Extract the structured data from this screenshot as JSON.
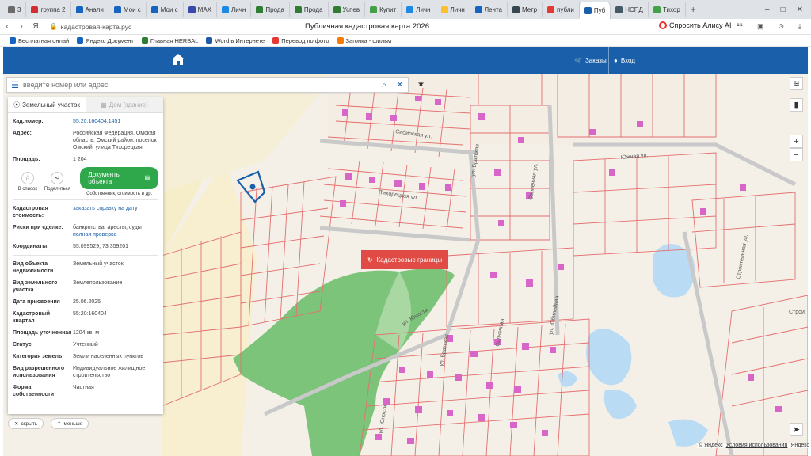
{
  "browser": {
    "tabs": [
      {
        "label": "3",
        "color": "#6b6b6b"
      },
      {
        "label": "группа 2",
        "color": "#d32f2f"
      },
      {
        "label": "Анали",
        "color": "#1565c0"
      },
      {
        "label": "Мои с",
        "color": "#1565c0"
      },
      {
        "label": "Мои с",
        "color": "#1565c0"
      },
      {
        "label": "MAX",
        "color": "#3949ab"
      },
      {
        "label": "Личн",
        "color": "#1e88e5"
      },
      {
        "label": "Прода",
        "color": "#2e7d32"
      },
      {
        "label": "Прода",
        "color": "#2e7d32"
      },
      {
        "label": "Успев",
        "color": "#2e7d32"
      },
      {
        "label": "Купит",
        "color": "#43a047"
      },
      {
        "label": "Личн",
        "color": "#1e88e5"
      },
      {
        "label": "Личн",
        "color": "#fbc02d"
      },
      {
        "label": "Лента",
        "color": "#1565c0"
      },
      {
        "label": "Метр",
        "color": "#37474f"
      },
      {
        "label": "публи",
        "color": "#e53935"
      },
      {
        "label": "Пуб",
        "color": "#1a5fa9",
        "active": true
      },
      {
        "label": "НСПД",
        "color": "#455a64"
      },
      {
        "label": "Тихор",
        "color": "#43a047"
      }
    ],
    "new_tab": "+",
    "url": "кадастровая-карта.рус",
    "page_title": "Публичная кадастровая карта 2026",
    "alisa": "Спросить Алису AI",
    "bookmarks": [
      {
        "label": "Бесплатная онлай",
        "color": "#1565c0"
      },
      {
        "label": "Яндекс Документ",
        "color": "#1565c0"
      },
      {
        "label": "Главная HERBAL",
        "color": "#2e7d32"
      },
      {
        "label": "Word в Интернете",
        "color": "#1e5aa8"
      },
      {
        "label": "Перевод по фото",
        "color": "#e53935"
      },
      {
        "label": "Загонка - фильм",
        "color": "#f57c00"
      }
    ]
  },
  "header": {
    "orders_label": "Заказы",
    "login_label": "Вход",
    "color": "#1a5fa9"
  },
  "search": {
    "placeholder": "введите номер или адрес"
  },
  "panel": {
    "tab_plot": "Земельный участок",
    "tab_building": "Дом (здание)",
    "cad_number_label": "Кад.номер:",
    "cad_number": "55:20:160404:1451",
    "address_label": "Адрес:",
    "address": "Российская Федерация, Омская область, Омский район, поселок Омский, улица Тихорецкая",
    "area_label": "Площадь:",
    "area": "1 204",
    "action_list": "В список",
    "action_share": "Поделиться",
    "docs_button": "Документы объекта",
    "docs_sub": "Собственник, стоимость и др.",
    "cad_cost_label": "Кадастровая стоимость:",
    "cad_cost_link": "заказать справку на дату",
    "risks_label": "Риски при сделке:",
    "risks_text": "банкротства, аресты, суды",
    "risks_link": "полная проверка",
    "coords_label": "Координаты:",
    "coords": "55.099529, 73.359201",
    "obj_type_label": "Вид объекта недвижимости",
    "obj_type": "Земельный участок",
    "land_type_label": "Вид земельного участка",
    "land_type": "Землепользование",
    "date_label": "Дата присвоения",
    "date": "25.06.2025",
    "quarter_label": "Кадастровый квартал",
    "quarter": "55:20:160404",
    "spec_area_label": "Площадь уточненная",
    "spec_area": "1204 кв. м",
    "status_label": "Статус",
    "status": "Учтенный",
    "category_label": "Категория земель",
    "category": "Земли населенных пунктов",
    "permitted_use_label": "Вид разрешенного использования",
    "permitted_use": "Индивидуальное жилищное строительство",
    "ownership_label": "Форма собственности",
    "ownership": "Частная",
    "hide_button": "скрыть",
    "less_button": "меньше"
  },
  "map": {
    "cadastre_button": "Кадастровые границы",
    "streets": [
      "Сибирская ул.",
      "Тихорецкая ул.",
      "ул. Братская",
      "Солнечная ул.",
      "Южная ул.",
      "Строительная ул.",
      "Строи",
      "ул. Юности",
      "Солнечная",
      "ул. Юности",
      "ул. Братская",
      "ул. Юбилейная"
    ],
    "zoom_in": "+",
    "zoom_out": "−",
    "attribution": [
      "© Яндекс",
      "Условия использования",
      "Яндекс"
    ]
  }
}
